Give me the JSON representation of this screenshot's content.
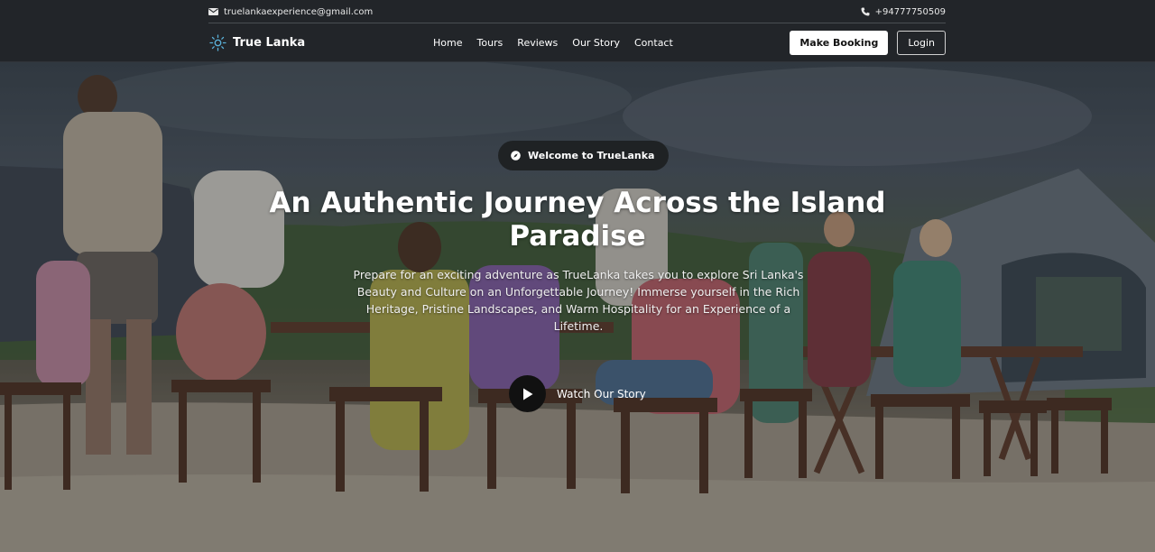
{
  "topbar": {
    "email": "truelankaexperience@gmail.com",
    "phone": "+94777750509"
  },
  "navbar": {
    "brand": "True Lanka",
    "links": [
      "Home",
      "Tours",
      "Reviews",
      "Our Story",
      "Contact"
    ],
    "book_label": "Make Booking",
    "login_label": "Login"
  },
  "hero": {
    "badge": "Welcome to TrueLanka",
    "title": "An Authentic Journey Across the Island Paradise",
    "description": "Prepare for an exciting adventure as TrueLanka takes you to explore Sri Lanka's Beauty and Culture on an Unforgettable Journey! Immerse yourself in the Rich Heritage, Pristine Landscapes, and Warm Hospitality for an Experience of a Lifetime.",
    "watch_label": "Watch Our Story"
  },
  "icons": {
    "email": "envelope-icon",
    "phone": "phone-icon",
    "logo": "sun-logo-icon",
    "badge": "compass-icon",
    "play": "play-icon"
  },
  "colors": {
    "header_bg": "#222529",
    "pill_bg": "#1f2224",
    "button_bg": "#ffffff"
  }
}
